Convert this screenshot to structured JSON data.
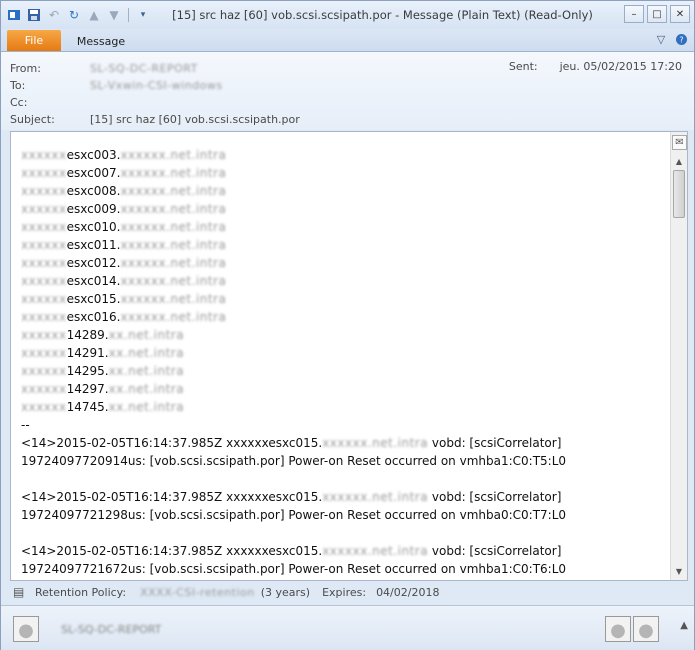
{
  "window": {
    "title": "[15] src haz [60] vob.scsi.scsipath.por  -  Message (Plain Text) (Read-Only)",
    "controls": [
      "–",
      "□",
      "✕"
    ]
  },
  "ribbon": {
    "tab_file": "File",
    "tab_message": "Message"
  },
  "header": {
    "from_label": "From:",
    "from_value": "SL-SQ-DC-REPORT",
    "to_label": "To:",
    "to_value": "SL-Vxwin-CSI-windows",
    "cc_label": "Cc:",
    "subject_label": "Subject:",
    "subject_value": "[15] src haz [60] vob.scsi.scsipath.por",
    "sent_label": "Sent:",
    "sent_value": "jeu. 05/02/2015 17:20"
  },
  "body": {
    "hosts": [
      {
        "prefix": "xxxxxx",
        "name": "esxc003.",
        "suffix": "xxxxxx.net.intra"
      },
      {
        "prefix": "xxxxxx",
        "name": "esxc007.",
        "suffix": "xxxxxx.net.intra"
      },
      {
        "prefix": "xxxxxx",
        "name": "esxc008.",
        "suffix": "xxxxxx.net.intra"
      },
      {
        "prefix": "xxxxxx",
        "name": "esxc009.",
        "suffix": "xxxxxx.net.intra"
      },
      {
        "prefix": "xxxxxx",
        "name": "esxc010.",
        "suffix": "xxxxxx.net.intra"
      },
      {
        "prefix": "xxxxxx",
        "name": "esxc011.",
        "suffix": "xxxxxx.net.intra"
      },
      {
        "prefix": "xxxxxx",
        "name": "esxc012.",
        "suffix": "xxxxxx.net.intra"
      },
      {
        "prefix": "xxxxxx",
        "name": "esxc014.",
        "suffix": "xxxxxx.net.intra"
      },
      {
        "prefix": "xxxxxx",
        "name": "esxc015.",
        "suffix": "xxxxxx.net.intra"
      },
      {
        "prefix": "xxxxxx",
        "name": "esxc016.",
        "suffix": "xxxxxx.net.intra"
      },
      {
        "prefix": "xxxxxx",
        "name": "14289.",
        "suffix": "xx.net.intra"
      },
      {
        "prefix": "xxxxxx",
        "name": "14291.",
        "suffix": "xx.net.intra"
      },
      {
        "prefix": "xxxxxx",
        "name": "14295.",
        "suffix": "xx.net.intra"
      },
      {
        "prefix": "xxxxxx",
        "name": "14297.",
        "suffix": "xx.net.intra"
      },
      {
        "prefix": "xxxxxx",
        "name": "14745.",
        "suffix": "xx.net.intra"
      }
    ],
    "separator": "--",
    "entries": [
      {
        "line1_start": "<14>2015-02-05T16:14:37.985Z ",
        "line1_host": "xxxxxxesxc015.",
        "line1_blur": "xxxxxx.net.intra",
        "line1_end": " vobd:  [scsiCorrelator]",
        "line2": "19724097720914us: [vob.scsi.scsipath.por] Power-on Reset occurred on vmhba1:C0:T5:L0"
      },
      {
        "line1_start": "<14>2015-02-05T16:14:37.985Z ",
        "line1_host": "xxxxxxesxc015.",
        "line1_blur": "xxxxxx.net.intra",
        "line1_end": " vobd:  [scsiCorrelator]",
        "line2": "19724097721298us: [vob.scsi.scsipath.por] Power-on Reset occurred on vmhba0:C0:T7:L0"
      },
      {
        "line1_start": "<14>2015-02-05T16:14:37.985Z ",
        "line1_host": "xxxxxxesxc015.",
        "line1_blur": "xxxxxx.net.intra",
        "line1_end": " vobd:  [scsiCorrelator]",
        "line2": "19724097721672us: [vob.scsi.scsipath.por] Power-on Reset occurred on vmhba1:C0:T6:L0"
      }
    ]
  },
  "retention": {
    "label": "Retention Policy:",
    "value": "XXXX-CSI-retention",
    "years": "(3 years)",
    "expires_label": "Expires:",
    "expires_value": "04/02/2018"
  },
  "people": {
    "name": "SL-SQ-DC-REPORT",
    "toggle": "▲"
  }
}
